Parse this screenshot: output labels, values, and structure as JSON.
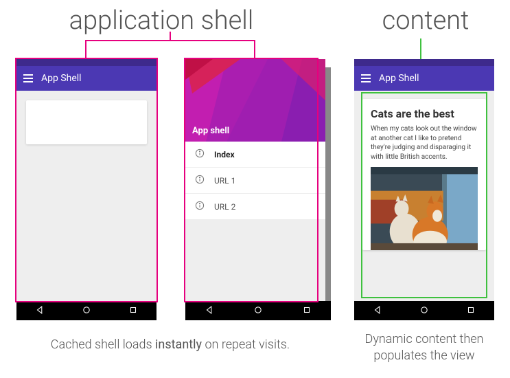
{
  "headings": {
    "left": "application shell",
    "right": "content"
  },
  "colors": {
    "magenta": "#e6007e",
    "green": "#3fc13f",
    "appbar": "#4b38b3"
  },
  "app": {
    "title": "App Shell"
  },
  "drawer": {
    "hero_label": "App shell",
    "items": [
      {
        "label": "Index",
        "active": true
      },
      {
        "label": "URL 1",
        "active": false
      },
      {
        "label": "URL 2",
        "active": false
      }
    ]
  },
  "content": {
    "title": "Cats are the best",
    "body": "When my cats look out the window at another cat I like to pretend they're judging and disparaging it with little British accents."
  },
  "captions": {
    "left_pre": "Cached shell loads ",
    "left_bold": "instantly",
    "left_post": " on repeat visits.",
    "right": "Dynamic content then populates the view"
  }
}
